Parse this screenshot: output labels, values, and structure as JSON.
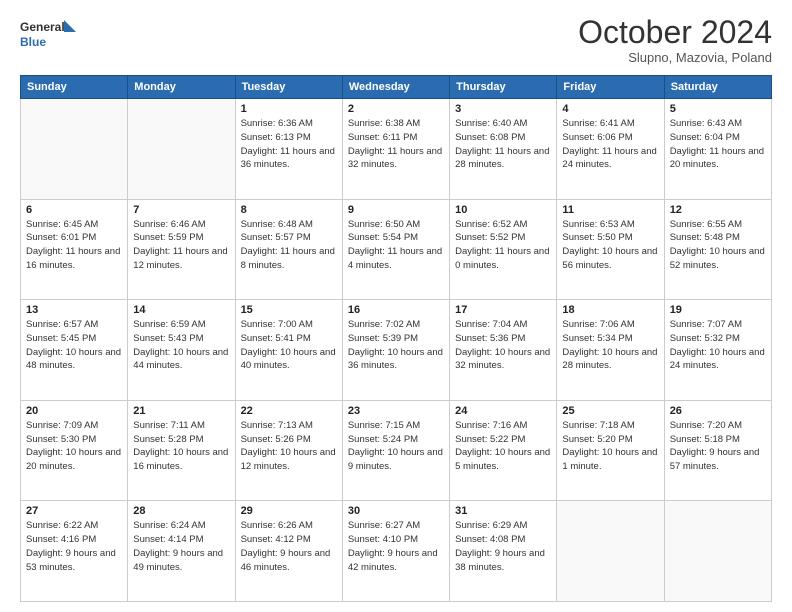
{
  "header": {
    "logo_line1": "General",
    "logo_line2": "Blue",
    "month_title": "October 2024",
    "subtitle": "Slupno, Mazovia, Poland"
  },
  "weekdays": [
    "Sunday",
    "Monday",
    "Tuesday",
    "Wednesday",
    "Thursday",
    "Friday",
    "Saturday"
  ],
  "weeks": [
    [
      {
        "day": "",
        "info": ""
      },
      {
        "day": "",
        "info": ""
      },
      {
        "day": "1",
        "info": "Sunrise: 6:36 AM\nSunset: 6:13 PM\nDaylight: 11 hours and 36 minutes."
      },
      {
        "day": "2",
        "info": "Sunrise: 6:38 AM\nSunset: 6:11 PM\nDaylight: 11 hours and 32 minutes."
      },
      {
        "day": "3",
        "info": "Sunrise: 6:40 AM\nSunset: 6:08 PM\nDaylight: 11 hours and 28 minutes."
      },
      {
        "day": "4",
        "info": "Sunrise: 6:41 AM\nSunset: 6:06 PM\nDaylight: 11 hours and 24 minutes."
      },
      {
        "day": "5",
        "info": "Sunrise: 6:43 AM\nSunset: 6:04 PM\nDaylight: 11 hours and 20 minutes."
      }
    ],
    [
      {
        "day": "6",
        "info": "Sunrise: 6:45 AM\nSunset: 6:01 PM\nDaylight: 11 hours and 16 minutes."
      },
      {
        "day": "7",
        "info": "Sunrise: 6:46 AM\nSunset: 5:59 PM\nDaylight: 11 hours and 12 minutes."
      },
      {
        "day": "8",
        "info": "Sunrise: 6:48 AM\nSunset: 5:57 PM\nDaylight: 11 hours and 8 minutes."
      },
      {
        "day": "9",
        "info": "Sunrise: 6:50 AM\nSunset: 5:54 PM\nDaylight: 11 hours and 4 minutes."
      },
      {
        "day": "10",
        "info": "Sunrise: 6:52 AM\nSunset: 5:52 PM\nDaylight: 11 hours and 0 minutes."
      },
      {
        "day": "11",
        "info": "Sunrise: 6:53 AM\nSunset: 5:50 PM\nDaylight: 10 hours and 56 minutes."
      },
      {
        "day": "12",
        "info": "Sunrise: 6:55 AM\nSunset: 5:48 PM\nDaylight: 10 hours and 52 minutes."
      }
    ],
    [
      {
        "day": "13",
        "info": "Sunrise: 6:57 AM\nSunset: 5:45 PM\nDaylight: 10 hours and 48 minutes."
      },
      {
        "day": "14",
        "info": "Sunrise: 6:59 AM\nSunset: 5:43 PM\nDaylight: 10 hours and 44 minutes."
      },
      {
        "day": "15",
        "info": "Sunrise: 7:00 AM\nSunset: 5:41 PM\nDaylight: 10 hours and 40 minutes."
      },
      {
        "day": "16",
        "info": "Sunrise: 7:02 AM\nSunset: 5:39 PM\nDaylight: 10 hours and 36 minutes."
      },
      {
        "day": "17",
        "info": "Sunrise: 7:04 AM\nSunset: 5:36 PM\nDaylight: 10 hours and 32 minutes."
      },
      {
        "day": "18",
        "info": "Sunrise: 7:06 AM\nSunset: 5:34 PM\nDaylight: 10 hours and 28 minutes."
      },
      {
        "day": "19",
        "info": "Sunrise: 7:07 AM\nSunset: 5:32 PM\nDaylight: 10 hours and 24 minutes."
      }
    ],
    [
      {
        "day": "20",
        "info": "Sunrise: 7:09 AM\nSunset: 5:30 PM\nDaylight: 10 hours and 20 minutes."
      },
      {
        "day": "21",
        "info": "Sunrise: 7:11 AM\nSunset: 5:28 PM\nDaylight: 10 hours and 16 minutes."
      },
      {
        "day": "22",
        "info": "Sunrise: 7:13 AM\nSunset: 5:26 PM\nDaylight: 10 hours and 12 minutes."
      },
      {
        "day": "23",
        "info": "Sunrise: 7:15 AM\nSunset: 5:24 PM\nDaylight: 10 hours and 9 minutes."
      },
      {
        "day": "24",
        "info": "Sunrise: 7:16 AM\nSunset: 5:22 PM\nDaylight: 10 hours and 5 minutes."
      },
      {
        "day": "25",
        "info": "Sunrise: 7:18 AM\nSunset: 5:20 PM\nDaylight: 10 hours and 1 minute."
      },
      {
        "day": "26",
        "info": "Sunrise: 7:20 AM\nSunset: 5:18 PM\nDaylight: 9 hours and 57 minutes."
      }
    ],
    [
      {
        "day": "27",
        "info": "Sunrise: 6:22 AM\nSunset: 4:16 PM\nDaylight: 9 hours and 53 minutes."
      },
      {
        "day": "28",
        "info": "Sunrise: 6:24 AM\nSunset: 4:14 PM\nDaylight: 9 hours and 49 minutes."
      },
      {
        "day": "29",
        "info": "Sunrise: 6:26 AM\nSunset: 4:12 PM\nDaylight: 9 hours and 46 minutes."
      },
      {
        "day": "30",
        "info": "Sunrise: 6:27 AM\nSunset: 4:10 PM\nDaylight: 9 hours and 42 minutes."
      },
      {
        "day": "31",
        "info": "Sunrise: 6:29 AM\nSunset: 4:08 PM\nDaylight: 9 hours and 38 minutes."
      },
      {
        "day": "",
        "info": ""
      },
      {
        "day": "",
        "info": ""
      }
    ]
  ]
}
